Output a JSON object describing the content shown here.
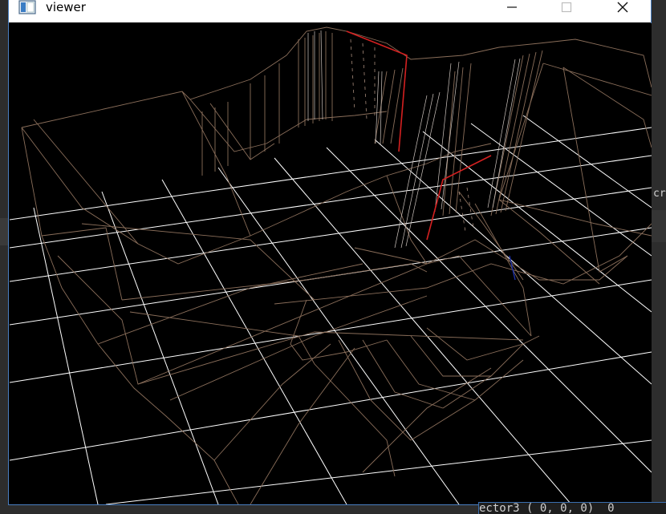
{
  "window": {
    "title": "viewer",
    "minimize_glyph": "—",
    "maximize_glyph": "☐",
    "close_glyph": "✕"
  },
  "side_text": "cr",
  "terminal_snippet": "ector3 ( 0, 0, 0)  0",
  "colors": {
    "grid": "#ffffff",
    "mesh": "#8a6e5a",
    "highlight": "#d42020",
    "axis_blue": "#1a2fa8",
    "viewport_bg": "#000000"
  },
  "icons": {
    "app": "app-window-icon",
    "minimize": "minimize-icon",
    "maximize": "maximize-icon",
    "close": "close-icon"
  }
}
